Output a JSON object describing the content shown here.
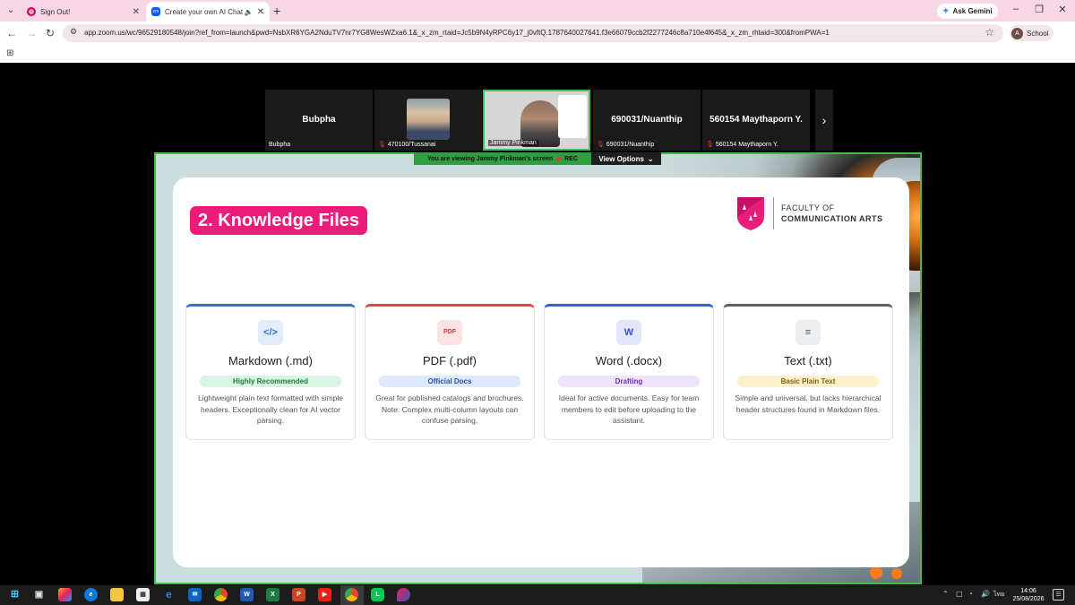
{
  "browser": {
    "tabs": [
      {
        "title": "Sign Out!",
        "active": false
      },
      {
        "title": "Create your own AI Chatbot",
        "active": true
      }
    ],
    "new_tab": "+",
    "ask_gemini": "Ask Gemini",
    "url": "app.zoom.us/wc/96529180548/join?ref_from=launch&pwd=NsbXR6YGA2NduTV7nr7YG8WesWZxa6.1&_x_zm_rtaid=Jc5b9N4yRPC6y17_j0vftQ.1787640027641.f3e66079ccb2f2277246c8a710e4f645&_x_zm_rhtaid=300&fromPWA=1",
    "profile": {
      "initial": "A",
      "name": "School"
    }
  },
  "meeting": {
    "participants": [
      {
        "name": "Bubpha",
        "label": "Bubpha",
        "muted": false,
        "video": false
      },
      {
        "name": "470100/Tussanai",
        "label": "470100/Tussanai",
        "muted": true,
        "video": true
      },
      {
        "name": "Jammy Pinkman",
        "label": "Jammy Pinkman",
        "muted": false,
        "video": true,
        "speaking": true
      },
      {
        "name": "690031/Nuanthip",
        "label": "690031/Nuanthip",
        "muted": true,
        "video": false
      },
      {
        "name": "560154 Maythaporn Y.",
        "label": "560154 Maythaporn Y.",
        "muted": true,
        "video": false
      }
    ],
    "viewing_banner": "You are viewing  Jammy Pinkman's screen",
    "rec_label": "REC",
    "view_options": "View Options"
  },
  "slide": {
    "title": "2. Knowledge Files",
    "faculty_line1": "FACULTY OF",
    "faculty_line2": "COMMUNICATION ARTS",
    "cards": [
      {
        "icon_glyph": "</>",
        "name": "Markdown (.md)",
        "badge": "Highly Recommended",
        "desc": "Lightweight plain text formatted with simple headers. Exceptionally clean for AI vector parsing.",
        "accent": "#3b6fd4",
        "badge_bg": "#d8f5e3",
        "badge_fg": "#1f7a3f",
        "icon_bg": "#e3ecfb",
        "icon_fg": "#3b6fd4"
      },
      {
        "icon_glyph": "PDF",
        "name": "PDF (.pdf)",
        "badge": "Official Docs",
        "desc": "Great for published catalogs and brochures. Note: Complex multi-column layouts can confuse parsing.",
        "accent": "#e04444",
        "badge_bg": "#dde8fb",
        "badge_fg": "#2450a8",
        "icon_bg": "#fde3e3",
        "icon_fg": "#d93030"
      },
      {
        "icon_glyph": "W",
        "name": "Word (.docx)",
        "badge": "Drafting",
        "desc": "Ideal for active documents. Easy for team members to edit before uploading to the assistant.",
        "accent": "#3b5fd4",
        "badge_bg": "#efe3fb",
        "badge_fg": "#6a2fb0",
        "icon_bg": "#e3e6fb",
        "icon_fg": "#3b4fd4"
      },
      {
        "icon_glyph": "≡",
        "name": "Text (.txt)",
        "badge": "Basic Plain Text",
        "desc": "Simple and universal, but lacks hierarchical header structures found in Markdown files.",
        "accent": "#5a5f6a",
        "badge_bg": "#fbf1cc",
        "badge_fg": "#8a5a10",
        "icon_bg": "#eceef1",
        "icon_fg": "#4a4f5a"
      }
    ]
  },
  "taskbar": {
    "clock_time": "14:06",
    "clock_date": "25/08/2026",
    "lang": "ไทย"
  }
}
